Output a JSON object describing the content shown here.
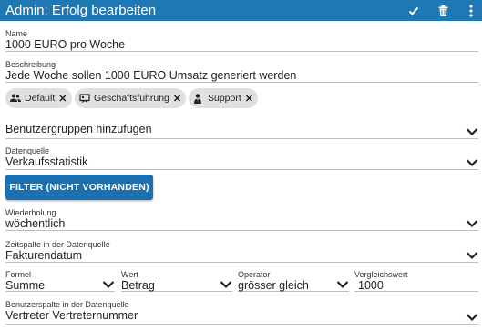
{
  "titlebar": {
    "title": "Admin: Erfolg bearbeiten",
    "background": "#1f77b4",
    "icons": [
      "check-icon",
      "trash-icon",
      "kebab-menu-icon"
    ]
  },
  "form": {
    "name": {
      "label": "Name",
      "value": "1000 EURO pro Woche"
    },
    "beschreibung": {
      "label": "Beschreibung",
      "value": "Jede Woche sollen 1000 EURO Umsatz generiert werden"
    },
    "chips": [
      {
        "label": "Default",
        "icon": "group-icon"
      },
      {
        "label": "Geschäftsführung",
        "icon": "chalkboard-icon"
      },
      {
        "label": "Support",
        "icon": "user-tie-icon"
      }
    ],
    "benutzergruppen": {
      "placeholder": "Benutzergruppen hinzufügen"
    },
    "datenquelle": {
      "label": "Datenquelle",
      "value": "Verkaufsstatistik"
    },
    "filter_button": "FILTER (NICHT VORHANDEN)",
    "wiederholung": {
      "label": "Wiederholung",
      "value": "wöchentlich"
    },
    "zeitspalte": {
      "label": "Zeitspalte in der Datenquelle",
      "value": "Fakturendatum"
    },
    "formel": {
      "label": "Formel",
      "value": "Summe"
    },
    "wert": {
      "label": "Wert",
      "value": "Betrag"
    },
    "operator": {
      "label": "Operator",
      "value": "grösser gleich"
    },
    "vergleichswert": {
      "label": "Vergleichswert",
      "value": "1000"
    },
    "benutzerspalte": {
      "label": "Benutzerspalte in der Datenquelle",
      "value": "Vertreter Vertreternummer"
    }
  },
  "colors": {
    "accent": "#1f77b4",
    "button": "#1a70b0",
    "chip": "#e0e0e0",
    "underline": "#bdbdbd"
  }
}
